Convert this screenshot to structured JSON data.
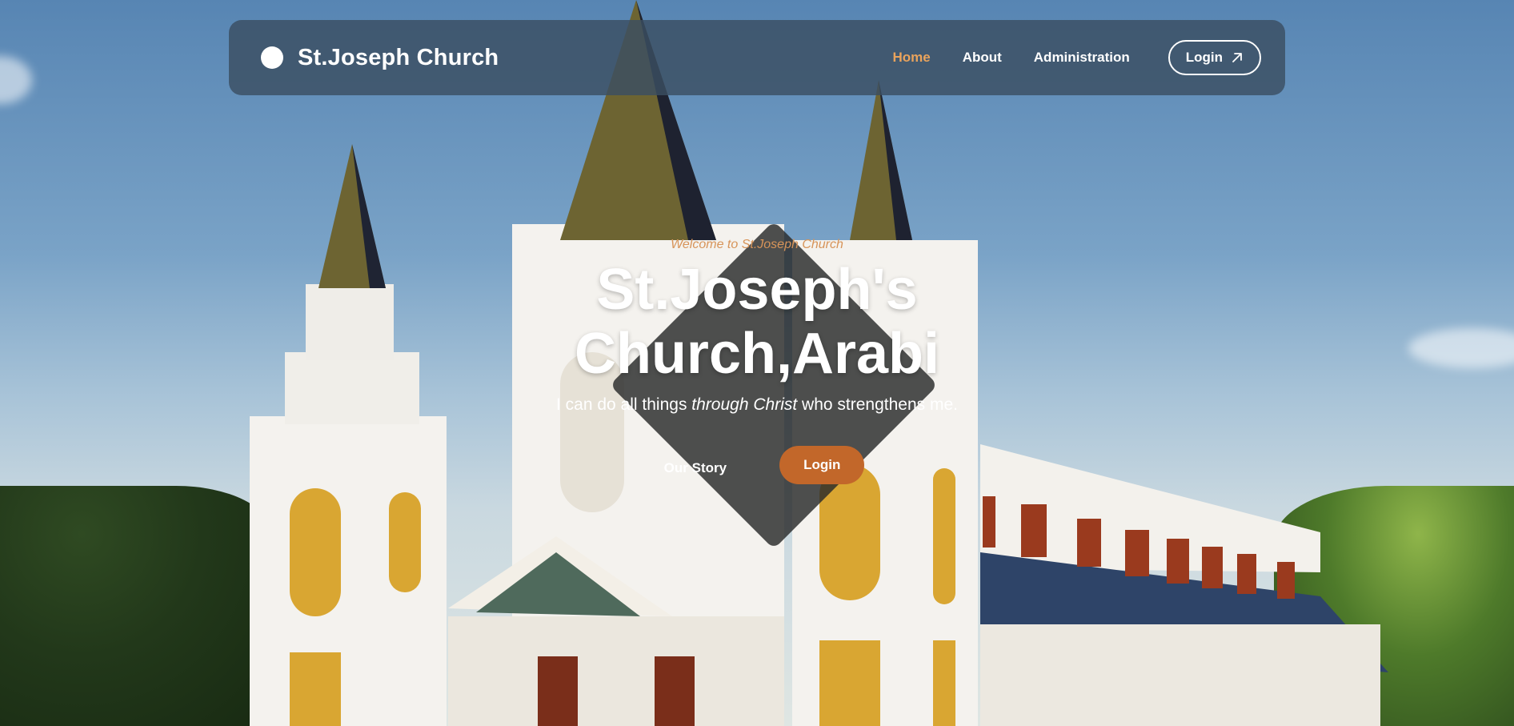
{
  "navbar": {
    "brand_name": "St.Joseph Church",
    "links": [
      {
        "label": "Home",
        "active": true
      },
      {
        "label": "About",
        "active": false
      },
      {
        "label": "Administration",
        "active": false
      }
    ],
    "login_label": "Login"
  },
  "hero": {
    "welcome": "Welcome to St.Joseph Church",
    "title_line1": "St.Joseph's",
    "title_line2": "Church,Arabi",
    "verse_part1": "I can do all things ",
    "verse_emphasis": "through Christ",
    "verse_part2": " who strengthens me.",
    "story_label": "Our Story",
    "login_label": "Login"
  },
  "colors": {
    "accent": "#e9a35c",
    "button": "#c2672a",
    "navbar_bg": "#3a4e61",
    "diamond_bg": "#282a2a"
  },
  "icons": {
    "brand": "white-circle-logo",
    "login_arrow": "arrow-up-right-icon"
  }
}
